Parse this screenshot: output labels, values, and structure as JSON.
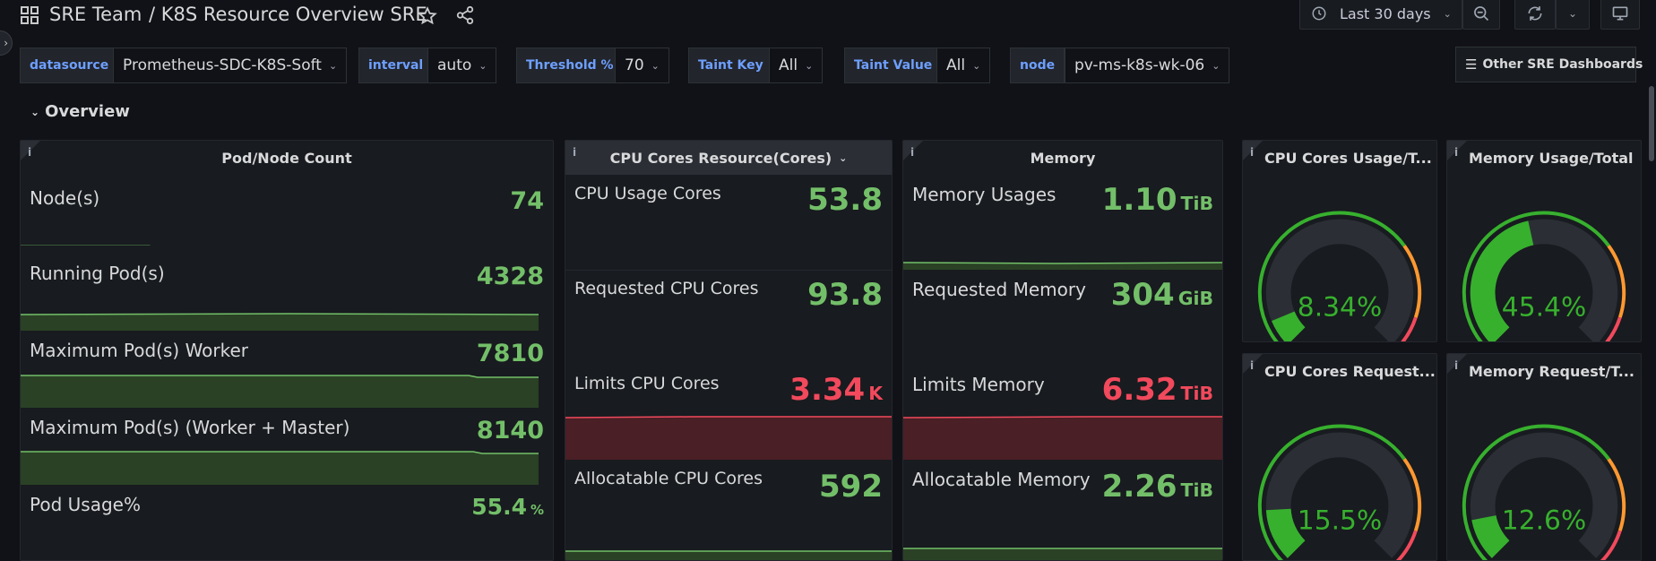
{
  "header": {
    "team": "SRE Team",
    "dashboard": "/ K8S Resource Overview SRE",
    "time_range": "Last 30 days"
  },
  "variables": [
    {
      "label": "datasource",
      "value": "Prometheus-SDC-K8S-Soft"
    },
    {
      "label": "interval",
      "value": "auto"
    },
    {
      "label": "Threshold %",
      "value": "70"
    },
    {
      "label": "Taint Key",
      "value": "All"
    },
    {
      "label": "Taint Value",
      "value": "All"
    },
    {
      "label": "node",
      "value": "pv-ms-k8s-wk-06"
    }
  ],
  "other_dashboards": "Other SRE Dashboards",
  "row_title": "Overview",
  "pod_node": {
    "title": "Pod/Node Count",
    "stats": [
      {
        "label": "Node(s)",
        "value": "74",
        "unit": ""
      },
      {
        "label": "Running Pod(s)",
        "value": "4328",
        "unit": ""
      },
      {
        "label": "Maximum Pod(s) Worker",
        "value": "7810",
        "unit": ""
      },
      {
        "label": "Maximum Pod(s) (Worker + Master)",
        "value": "8140",
        "unit": ""
      },
      {
        "label": "Pod Usage%",
        "value": "55.4",
        "unit": "%"
      }
    ]
  },
  "cpu": {
    "title": "CPU Cores Resource(Cores)",
    "stats": [
      {
        "label": "CPU Usage Cores",
        "value": "53.8",
        "unit": ""
      },
      {
        "label": "Requested CPU Cores",
        "value": "93.8",
        "unit": ""
      },
      {
        "label": "Limits CPU Cores",
        "value": "3.34",
        "unit": "K"
      },
      {
        "label": "Allocatable CPU Cores",
        "value": "592",
        "unit": ""
      }
    ]
  },
  "memory": {
    "title": "Memory",
    "stats": [
      {
        "label": "Memory Usages",
        "value": "1.10",
        "unit": "TiB"
      },
      {
        "label": "Requested Memory",
        "value": "304",
        "unit": "GiB"
      },
      {
        "label": "Limits Memory",
        "value": "6.32",
        "unit": "TiB"
      },
      {
        "label": "Allocatable Memory",
        "value": "2.26",
        "unit": "TiB"
      }
    ]
  },
  "gauges": [
    {
      "title": "CPU Cores Usage/T...",
      "value_text": "8.34%",
      "fraction": 0.0834
    },
    {
      "title": "Memory Usage/Total",
      "value_text": "45.4%",
      "fraction": 0.454
    },
    {
      "title": "CPU Cores Request...",
      "value_text": "15.5%",
      "fraction": 0.155
    },
    {
      "title": "Memory Request/T...",
      "value_text": "12.6%",
      "fraction": 0.126
    }
  ],
  "colors": {
    "green": "#73bf69",
    "red": "#f2495c",
    "gauge_green": "#37b02e",
    "orange": "#ff9830"
  }
}
